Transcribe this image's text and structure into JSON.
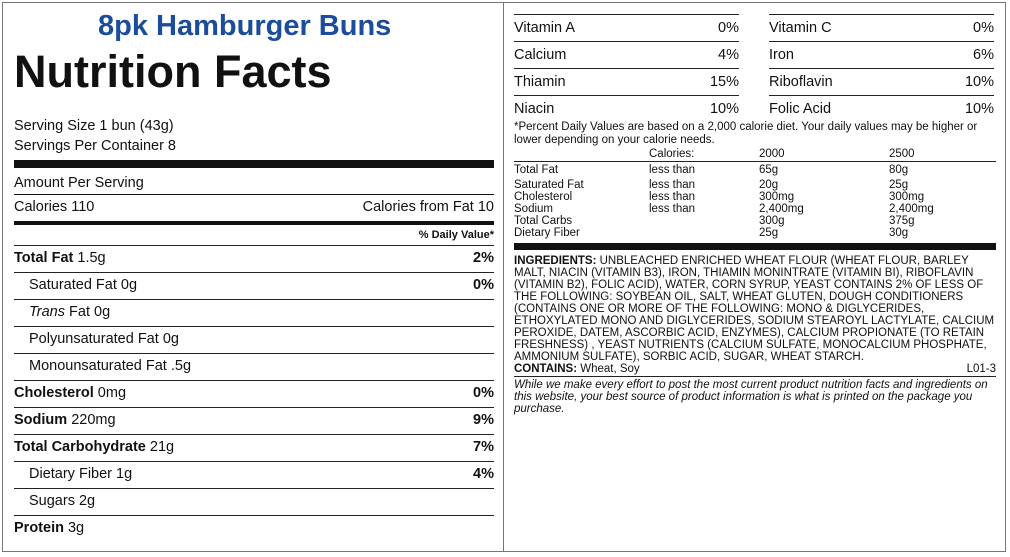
{
  "product_title": "8pk Hamburger Buns",
  "nutrition_title": "Nutrition Facts",
  "serving_size": "Serving Size 1 bun (43g)",
  "servings_per_container": "Servings Per Container 8",
  "amount_per_serving": "Amount Per Serving",
  "calories": "Calories 110",
  "calories_from_fat": "Calories from Fat 10",
  "daily_value_header": "% Daily Value*",
  "nutrients": [
    {
      "name": "Total Fat",
      "amount": "1.5g",
      "pct": "2%"
    },
    {
      "name": "Saturated Fat",
      "amount": "0g",
      "pct": "0%"
    },
    {
      "name": "Trans",
      "amount": "Fat 0g",
      "pct": ""
    },
    {
      "name": "Polyunsaturated Fat",
      "amount": "0g",
      "pct": ""
    },
    {
      "name": "Monounsaturated Fat",
      "amount": ".5g",
      "pct": ""
    },
    {
      "name": "Cholesterol",
      "amount": "0mg",
      "pct": "0%"
    },
    {
      "name": "Sodium",
      "amount": "220mg",
      "pct": "9%"
    },
    {
      "name": "Total Carbohydrate",
      "amount": "21g",
      "pct": "7%"
    },
    {
      "name": "Dietary Fiber",
      "amount": "1g",
      "pct": "4%"
    },
    {
      "name": "Sugars",
      "amount": "2g",
      "pct": ""
    },
    {
      "name": "Protein",
      "amount": "3g",
      "pct": ""
    }
  ],
  "vitamins_left": [
    {
      "name": "Vitamin A",
      "pct": "0%"
    },
    {
      "name": "Calcium",
      "pct": "4%"
    },
    {
      "name": "Thiamin",
      "pct": "15%"
    },
    {
      "name": "Niacin",
      "pct": "10%"
    }
  ],
  "vitamins_right": [
    {
      "name": "Vitamin C",
      "pct": "0%"
    },
    {
      "name": "Iron",
      "pct": "6%"
    },
    {
      "name": "Riboflavin",
      "pct": "10%"
    },
    {
      "name": "Folic Acid",
      "pct": "10%"
    }
  ],
  "footnote": "*Percent Daily Values are based on a 2,000 calorie diet. Your daily values may be higher or lower depending on your calorie needs.",
  "dv_table": {
    "header": [
      "",
      "Calories:",
      "2000",
      "2500"
    ],
    "rows": [
      [
        "Total Fat",
        "less than",
        "65g",
        "80g"
      ],
      [
        "Saturated Fat",
        "less than",
        "20g",
        "25g"
      ],
      [
        "Cholesterol",
        "less than",
        "300mg",
        "300mg"
      ],
      [
        "Sodium",
        "less than",
        "2,400mg",
        "2,400mg"
      ],
      [
        "Total Carbs",
        "",
        "300g",
        "375g"
      ],
      [
        "Dietary Fiber",
        "",
        "25g",
        "30g"
      ]
    ]
  },
  "ingredients_label": "INGREDIENTS:",
  "ingredients_text": "UNBLEACHED ENRICHED WHEAT FLOUR (WHEAT FLOUR, BARLEY MALT, NIACIN (VITAMIN B3), IRON, THIAMIN MONINTRATE (VITAMIN BI), RIBOFLAVIN (VITAMIN B2), FOLIC ACID), WATER, CORN SYRUP, YEAST CONTAINS 2% OF LESS OF THE FOLLOWING: SOYBEAN OIL, SALT, WHEAT GLUTEN, DOUGH CONDITIONERS (CONTAINS ONE OR MORE OF THE FOLLOWING: MONO & DIGLYCERIDES, ETHOXYLATED MONO AND DIGLYCERIDES, SODIUM STEAROYL LACTYLATE, CALCIUM PEROXIDE, DATEM, ASCORBIC ACID, ENZYMES), CALCIUM PROPIONATE (TO RETAIN FRESHNESS) , YEAST NUTRIENTS (CALCIUM SULFATE, MONOCALCIUM PHOSPHATE, AMMONIUM SULFATE), SORBIC ACID, SUGAR, WHEAT STARCH.",
  "contains_label": "CONTAINS:",
  "contains_text": "Wheat, Soy",
  "code": "L01-3",
  "disclaimer": "While we make every effort to post the most current product nutrition facts and ingredients on this website, your best source of product information is what is printed on the package you purchase."
}
